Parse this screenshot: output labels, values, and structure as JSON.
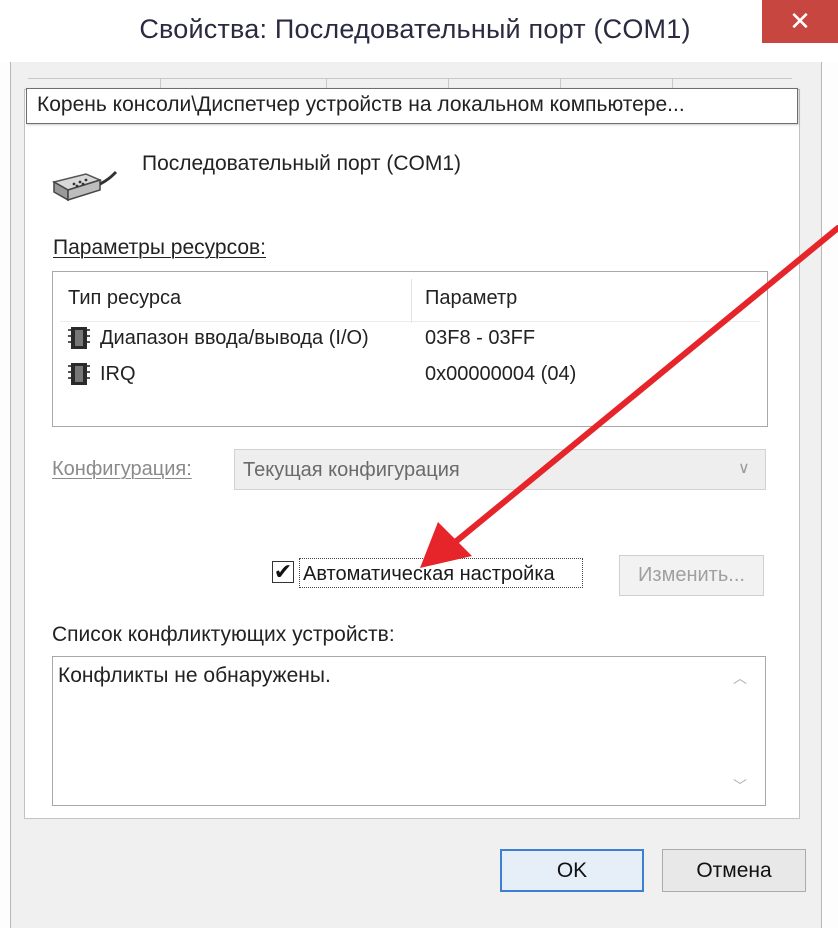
{
  "window": {
    "title": "Свойства: Последовательный порт (COM1)",
    "close_glyph": "✕",
    "path": "Корень консоли\\Диспетчер устройств на локальном компьютере..."
  },
  "device": {
    "name": "Последовательный порт (COM1)",
    "icon": "serial-port-icon"
  },
  "resources": {
    "label": "Параметры ресурсов:",
    "columns": [
      "Тип ресурса",
      "Параметр"
    ],
    "rows": [
      {
        "type": "Диапазон ввода/вывода (I/O)",
        "value": "03F8 - 03FF",
        "icon": "chip-icon"
      },
      {
        "type": "IRQ",
        "value": "0x00000004 (04)",
        "icon": "chip-icon"
      }
    ]
  },
  "config": {
    "label": "Конфигурация:",
    "value": "Текущая конфигурация",
    "arrow": "∨"
  },
  "auto_config": {
    "label": "Автоматическая настройка",
    "checked": true,
    "check_glyph": "✔"
  },
  "change_button": {
    "label": "Изменить..."
  },
  "conflicts": {
    "label": "Список конфликтующих устройств:",
    "text": "Конфликты не обнаружены.",
    "scroll_up": "︿",
    "scroll_down": "﹀"
  },
  "buttons": {
    "ok": "OK",
    "cancel": "Отмена"
  },
  "colors": {
    "close_button": "#c7463f",
    "annotation_arrow": "#e5252a",
    "ok_border": "#3d7fd1"
  }
}
